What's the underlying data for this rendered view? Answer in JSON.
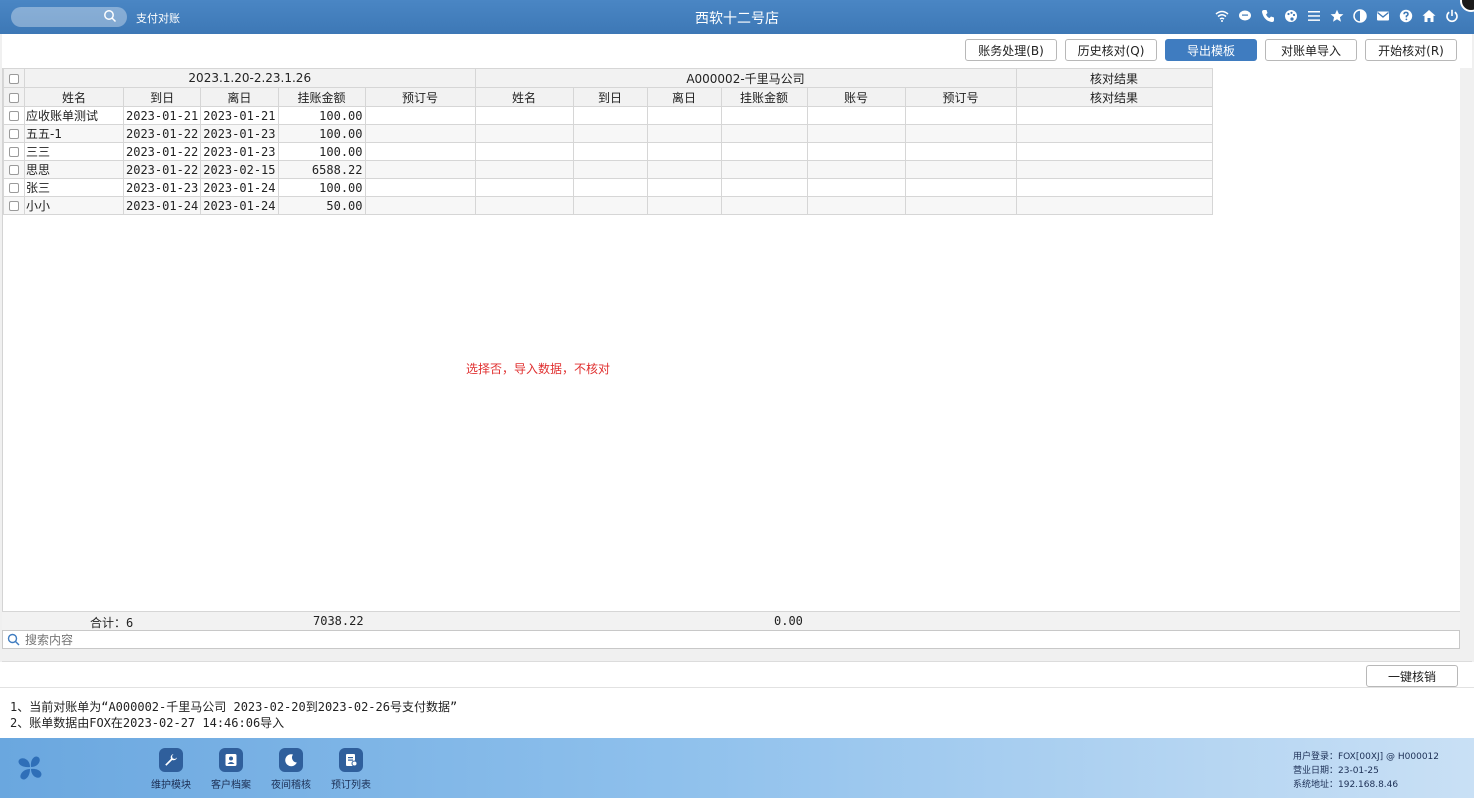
{
  "titlebar": {
    "menu": "支付对账",
    "title": "西软十二号店"
  },
  "toolbar": {
    "buttons": [
      "账务处理(B)",
      "历史核对(Q)",
      "导出模板",
      "对账单导入",
      "开始核对(R)"
    ]
  },
  "grid": {
    "group_left": "2023.1.20-2.23.1.26",
    "group_mid": "A000002-千里马公司",
    "group_right": "核对结果",
    "columns": [
      "姓名",
      "到日",
      "离日",
      "挂账金额",
      "预订号",
      "姓名",
      "到日",
      "离日",
      "挂账金额",
      "账号",
      "预订号",
      "核对结果"
    ],
    "rows": [
      [
        "应收账单测试",
        "2023-01-21",
        "2023-01-21",
        "100.00",
        ""
      ],
      [
        "五五-1",
        "2023-01-22",
        "2023-01-23",
        "100.00",
        ""
      ],
      [
        "三三",
        "2023-01-22",
        "2023-01-23",
        "100.00",
        ""
      ],
      [
        "思思",
        "2023-01-22",
        "2023-02-15",
        "6588.22",
        ""
      ],
      [
        "张三",
        "2023-01-23",
        "2023-01-24",
        "100.00",
        ""
      ],
      [
        "小小",
        "2023-01-24",
        "2023-01-24",
        "50.00",
        ""
      ]
    ]
  },
  "note": "选择否，导入数据，不核对",
  "summary": {
    "count_label": "合计：6",
    "total_left": "7038.22",
    "total_right": "0.00"
  },
  "search": {
    "placeholder": "搜索内容"
  },
  "action": {
    "one_click_label": "一键核销"
  },
  "info": {
    "line1": "1、当前对账单为“A000002-千里马公司 2023-02-20到2023-02-26号支付数据”",
    "line2": "2、账单数据由FOX在2023-02-27 14:46:06导入"
  },
  "dock": [
    {
      "label": "维护模块",
      "icon": "wrench-icon"
    },
    {
      "label": "客户档案",
      "icon": "contact-card-icon"
    },
    {
      "label": "夜间稽核",
      "icon": "moon-icon"
    },
    {
      "label": "预订列表",
      "icon": "booking-list-icon"
    }
  ],
  "status": {
    "user": "用户登录：FOX[00XJ] @ H000012",
    "date": "营业日期：23-01-25",
    "address": "系统地址：192.168.8.46"
  },
  "colors": {
    "titlebar": "#3d78b6",
    "primary_button": "#3f7cc0",
    "note": "#e03030"
  }
}
